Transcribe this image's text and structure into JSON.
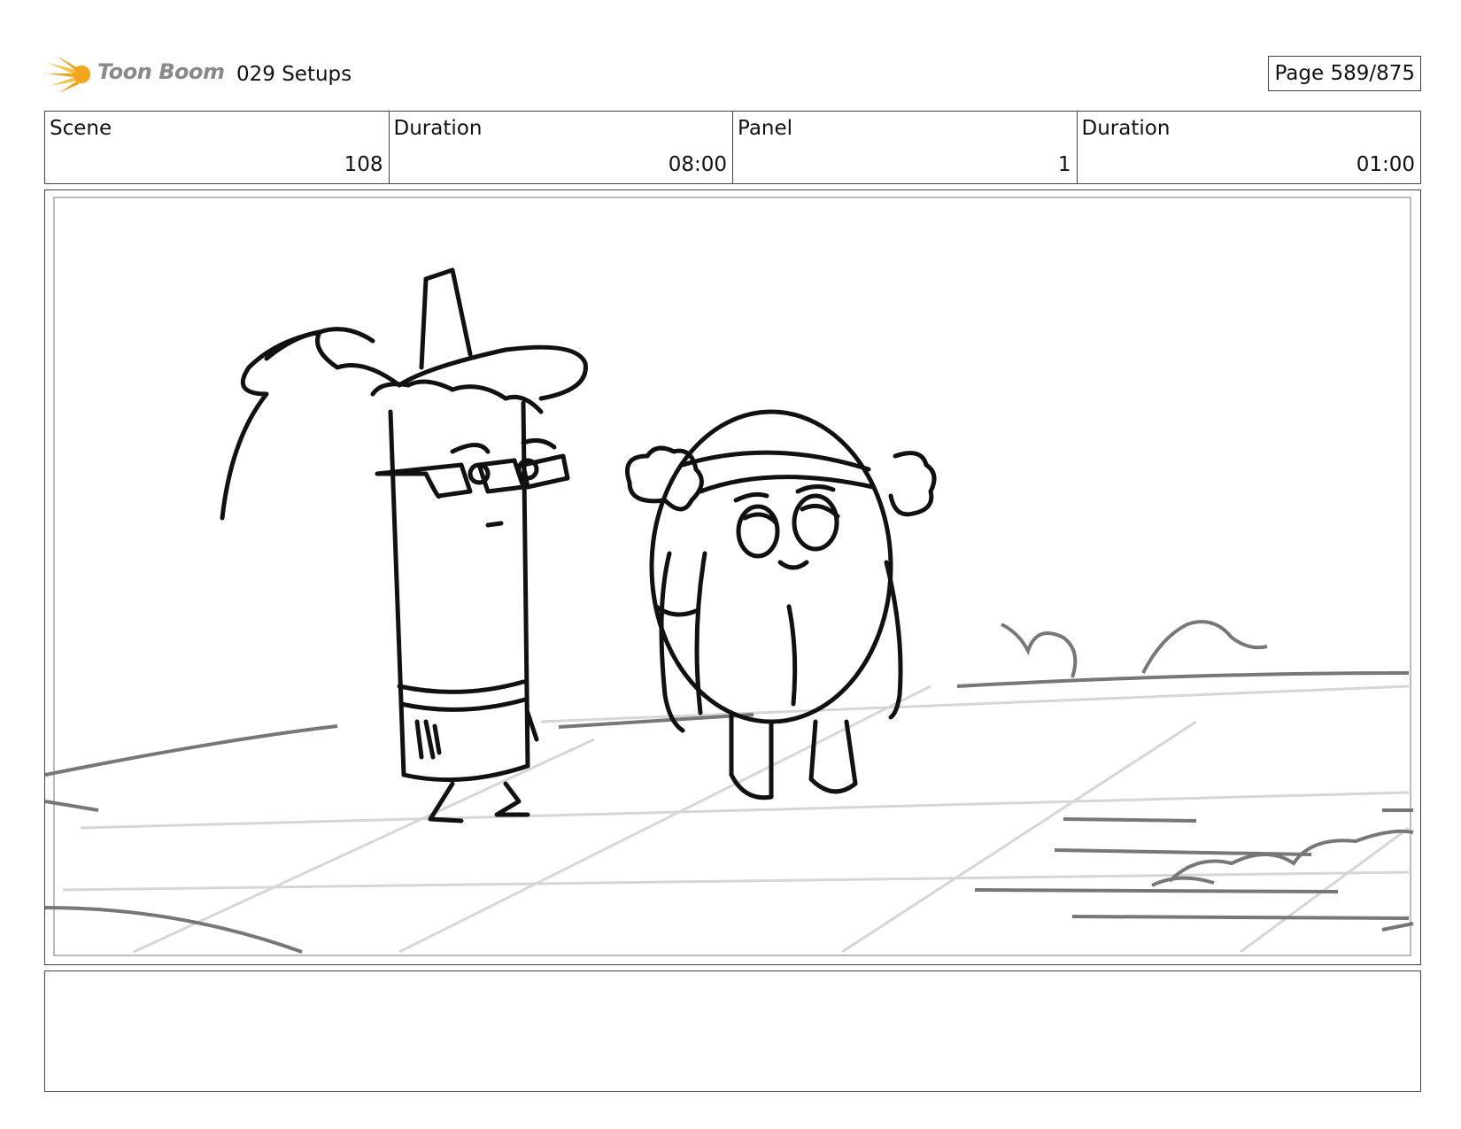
{
  "header": {
    "logo_text": "Toon Boom",
    "project_title": "029 Setups",
    "page_label": "Page 589/875"
  },
  "info": [
    {
      "label": "Scene",
      "value": "108"
    },
    {
      "label": "Duration",
      "value": "08:00"
    },
    {
      "label": "Panel",
      "value": "1"
    },
    {
      "label": "Duration",
      "value": "01:00"
    }
  ],
  "panel": {
    "image": "storyboard-sketch",
    "notes": ""
  },
  "colors": {
    "border": "#444444",
    "logo_orange": "#f5a51c",
    "logo_gray": "#8a8a8a"
  }
}
